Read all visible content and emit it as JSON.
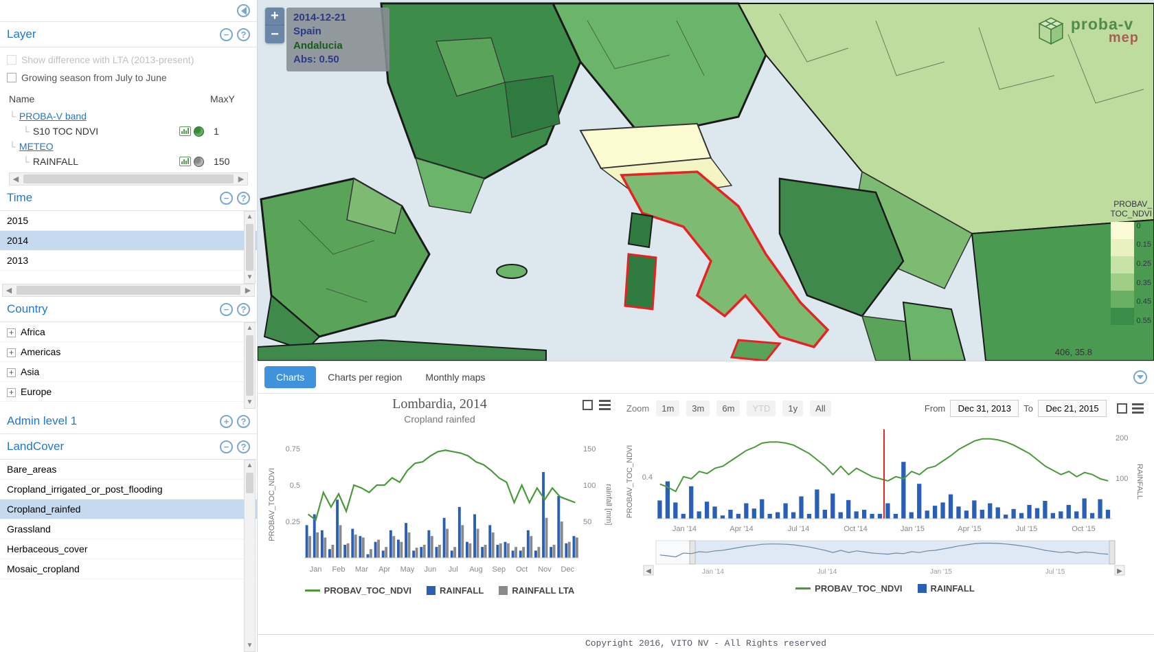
{
  "sidebar": {
    "layer": {
      "title": "Layer",
      "opt_diff": "Show difference with LTA (2013-present)",
      "opt_growing": "Growing season from July to June",
      "col_name": "Name",
      "col_maxy": "MaxY",
      "tree": {
        "band_group": "PROBA-V band",
        "band_item": "S10 TOC NDVI",
        "band_maxy": "1",
        "meteo_group": "METEO",
        "meteo_item": "RAINFALL",
        "meteo_maxy": "150"
      }
    },
    "time": {
      "title": "Time",
      "items": [
        "2015",
        "2014",
        "2013"
      ],
      "selected": "2014"
    },
    "country": {
      "title": "Country",
      "items": [
        "Africa",
        "Americas",
        "Asia",
        "Europe"
      ]
    },
    "admin1": {
      "title": "Admin level 1"
    },
    "landcover": {
      "title": "LandCover",
      "items": [
        "Bare_areas",
        "Cropland_irrigated_or_post_flooding",
        "Cropland_rainfed",
        "Grassland",
        "Herbaceous_cover",
        "Mosaic_cropland"
      ],
      "selected": "Cropland_rainfed"
    }
  },
  "map": {
    "tooltip": {
      "date": "2014-12-21",
      "country": "Spain",
      "region": "Andalucia",
      "abs_label": "Abs: 0.50"
    },
    "logo": {
      "t1": "proba-v",
      "t2": "mep"
    },
    "coords": "406, 35.8",
    "legend": {
      "title1": "PROBAV_",
      "title2": "TOC_NDVI",
      "stops": [
        "0",
        "0.15",
        "0.25",
        "0.35",
        "0.45",
        "0.55"
      ],
      "colors": [
        "#fbfbd8",
        "#e9f0c2",
        "#c8e3a8",
        "#9ecd85",
        "#6ab064",
        "#3a8c49"
      ]
    }
  },
  "tabs": {
    "charts": "Charts",
    "per_region": "Charts per region",
    "monthly": "Monthly maps"
  },
  "chart_data": [
    {
      "id": "left",
      "title": "Lombardia, 2014",
      "subtitle": "Cropland rainfed",
      "type": "combo",
      "x_axis": [
        "Jan",
        "Feb",
        "Mar",
        "Apr",
        "May",
        "Jun",
        "Jul",
        "Aug",
        "Sep",
        "Oct",
        "Nov",
        "Dec"
      ],
      "y1_label": "PROBAV_TOC_NDVI",
      "y1_ticks": [
        0.25,
        0.5,
        0.75
      ],
      "y2_label": "rainfall [mm]",
      "y2_ticks": [
        50,
        100,
        150
      ],
      "series": [
        {
          "name": "PROBAV_TOC_NDVI",
          "type": "line",
          "axis": "y1",
          "color": "#4a9a3a",
          "values": [
            0.3,
            0.26,
            0.45,
            0.35,
            0.44,
            0.32,
            0.5,
            0.48,
            0.45,
            0.5,
            0.5,
            0.55,
            0.52,
            0.6,
            0.65,
            0.66,
            0.7,
            0.73,
            0.74,
            0.73,
            0.72,
            0.7,
            0.66,
            0.64,
            0.6,
            0.55,
            0.52,
            0.38,
            0.5,
            0.38,
            0.48,
            0.4,
            0.48,
            0.42,
            0.4,
            0.38
          ]
        },
        {
          "name": "RAINFALL",
          "type": "bar",
          "axis": "y2",
          "color": "#2a5fb8",
          "values": [
            45,
            60,
            38,
            12,
            80,
            18,
            40,
            30,
            5,
            22,
            10,
            38,
            25,
            48,
            10,
            15,
            38,
            15,
            55,
            10,
            70,
            22,
            60,
            15,
            45,
            18,
            22,
            10,
            10,
            38,
            10,
            118,
            15,
            85,
            20,
            30
          ]
        },
        {
          "name": "RAINFALL LTA",
          "type": "bar",
          "axis": "y2",
          "color": "#8a8a8a",
          "values": [
            30,
            35,
            28,
            18,
            45,
            20,
            32,
            28,
            12,
            25,
            15,
            30,
            22,
            35,
            14,
            18,
            30,
            18,
            40,
            15,
            45,
            20,
            40,
            18,
            35,
            20,
            20,
            15,
            15,
            30,
            15,
            55,
            18,
            50,
            22,
            28
          ]
        }
      ],
      "legend": [
        "PROBAV_TOC_NDVI",
        "RAINFALL",
        "RAINFALL LTA"
      ]
    },
    {
      "id": "right",
      "type": "combo",
      "zoom_label": "Zoom",
      "zoom_buttons": [
        "1m",
        "3m",
        "6m",
        "YTD",
        "1y",
        "All"
      ],
      "from_label": "From",
      "to_label": "To",
      "from_value": "Dec 31, 2013",
      "to_value": "Dec 21, 2015",
      "x_axis": [
        "Jan '14",
        "Apr '14",
        "Jul '14",
        "Oct '14",
        "Jan '15",
        "Apr '15",
        "Jul '15",
        "Oct '15"
      ],
      "navigator_x": [
        "Jan '14",
        "Jul '14",
        "Jan '15",
        "Jul '15"
      ],
      "y1_label": "PROBAV_TOC_NDVI",
      "y1_ticks": [
        0.4
      ],
      "y2_label": "RAINFALL",
      "y2_ticks": [
        100,
        200
      ],
      "marker_date": "Dec 21, 2014",
      "series": [
        {
          "name": "PROBAV_TOC_NDVI",
          "type": "line",
          "axis": "y1",
          "color": "#4a9a3a",
          "values": [
            0.33,
            0.3,
            0.26,
            0.4,
            0.38,
            0.45,
            0.43,
            0.48,
            0.5,
            0.55,
            0.6,
            0.65,
            0.68,
            0.72,
            0.73,
            0.73,
            0.72,
            0.7,
            0.66,
            0.62,
            0.56,
            0.5,
            0.42,
            0.5,
            0.42,
            0.48,
            0.44,
            0.4,
            0.38,
            0.36,
            0.4,
            0.38,
            0.45,
            0.42,
            0.48,
            0.5,
            0.55,
            0.6,
            0.66,
            0.7,
            0.74,
            0.76,
            0.76,
            0.75,
            0.73,
            0.7,
            0.66,
            0.62,
            0.56,
            0.5,
            0.46,
            0.42,
            0.45,
            0.4,
            0.44,
            0.42,
            0.38,
            0.36
          ]
        },
        {
          "name": "RAINFALL",
          "type": "bar",
          "axis": "y2",
          "color": "#2a5fb8",
          "values": [
            45,
            92,
            40,
            12,
            80,
            18,
            42,
            30,
            8,
            22,
            12,
            38,
            25,
            48,
            12,
            16,
            38,
            16,
            55,
            12,
            72,
            22,
            62,
            16,
            46,
            18,
            22,
            12,
            12,
            38,
            12,
            140,
            16,
            86,
            20,
            32,
            40,
            60,
            30,
            20,
            45,
            22,
            38,
            28,
            10,
            24,
            14,
            34,
            26,
            44,
            14,
            18,
            34,
            18,
            50,
            14,
            48,
            22
          ]
        }
      ],
      "legend": [
        "PROBAV_TOC_NDVI",
        "RAINFALL"
      ]
    }
  ],
  "footer": "Copyright 2016, VITO NV - All Rights reserved"
}
